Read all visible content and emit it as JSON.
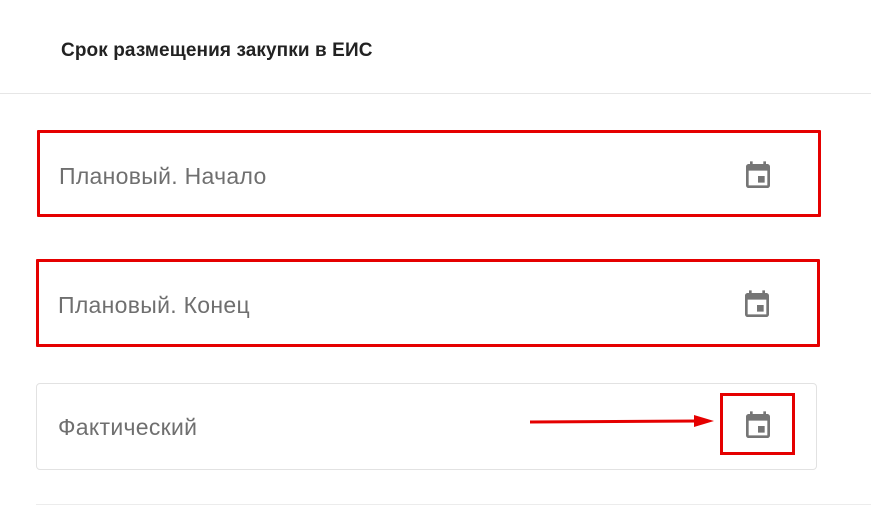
{
  "section": {
    "title": "Срок размещения закупки в ЕИС"
  },
  "fields": [
    {
      "label": "Плановый. Начало",
      "icon": "calendar-icon",
      "highlighted": true
    },
    {
      "label": "Плановый. Конец",
      "icon": "calendar-icon",
      "highlighted": true
    },
    {
      "label": "Фактический",
      "icon": "calendar-icon",
      "highlighted": false
    }
  ],
  "annotation": {
    "type": "arrow-to-calendar-icon",
    "color": "#e50000"
  },
  "colors": {
    "highlight": "#e50000",
    "label": "#6f6f6f",
    "icon": "#757575",
    "title": "#222222"
  }
}
